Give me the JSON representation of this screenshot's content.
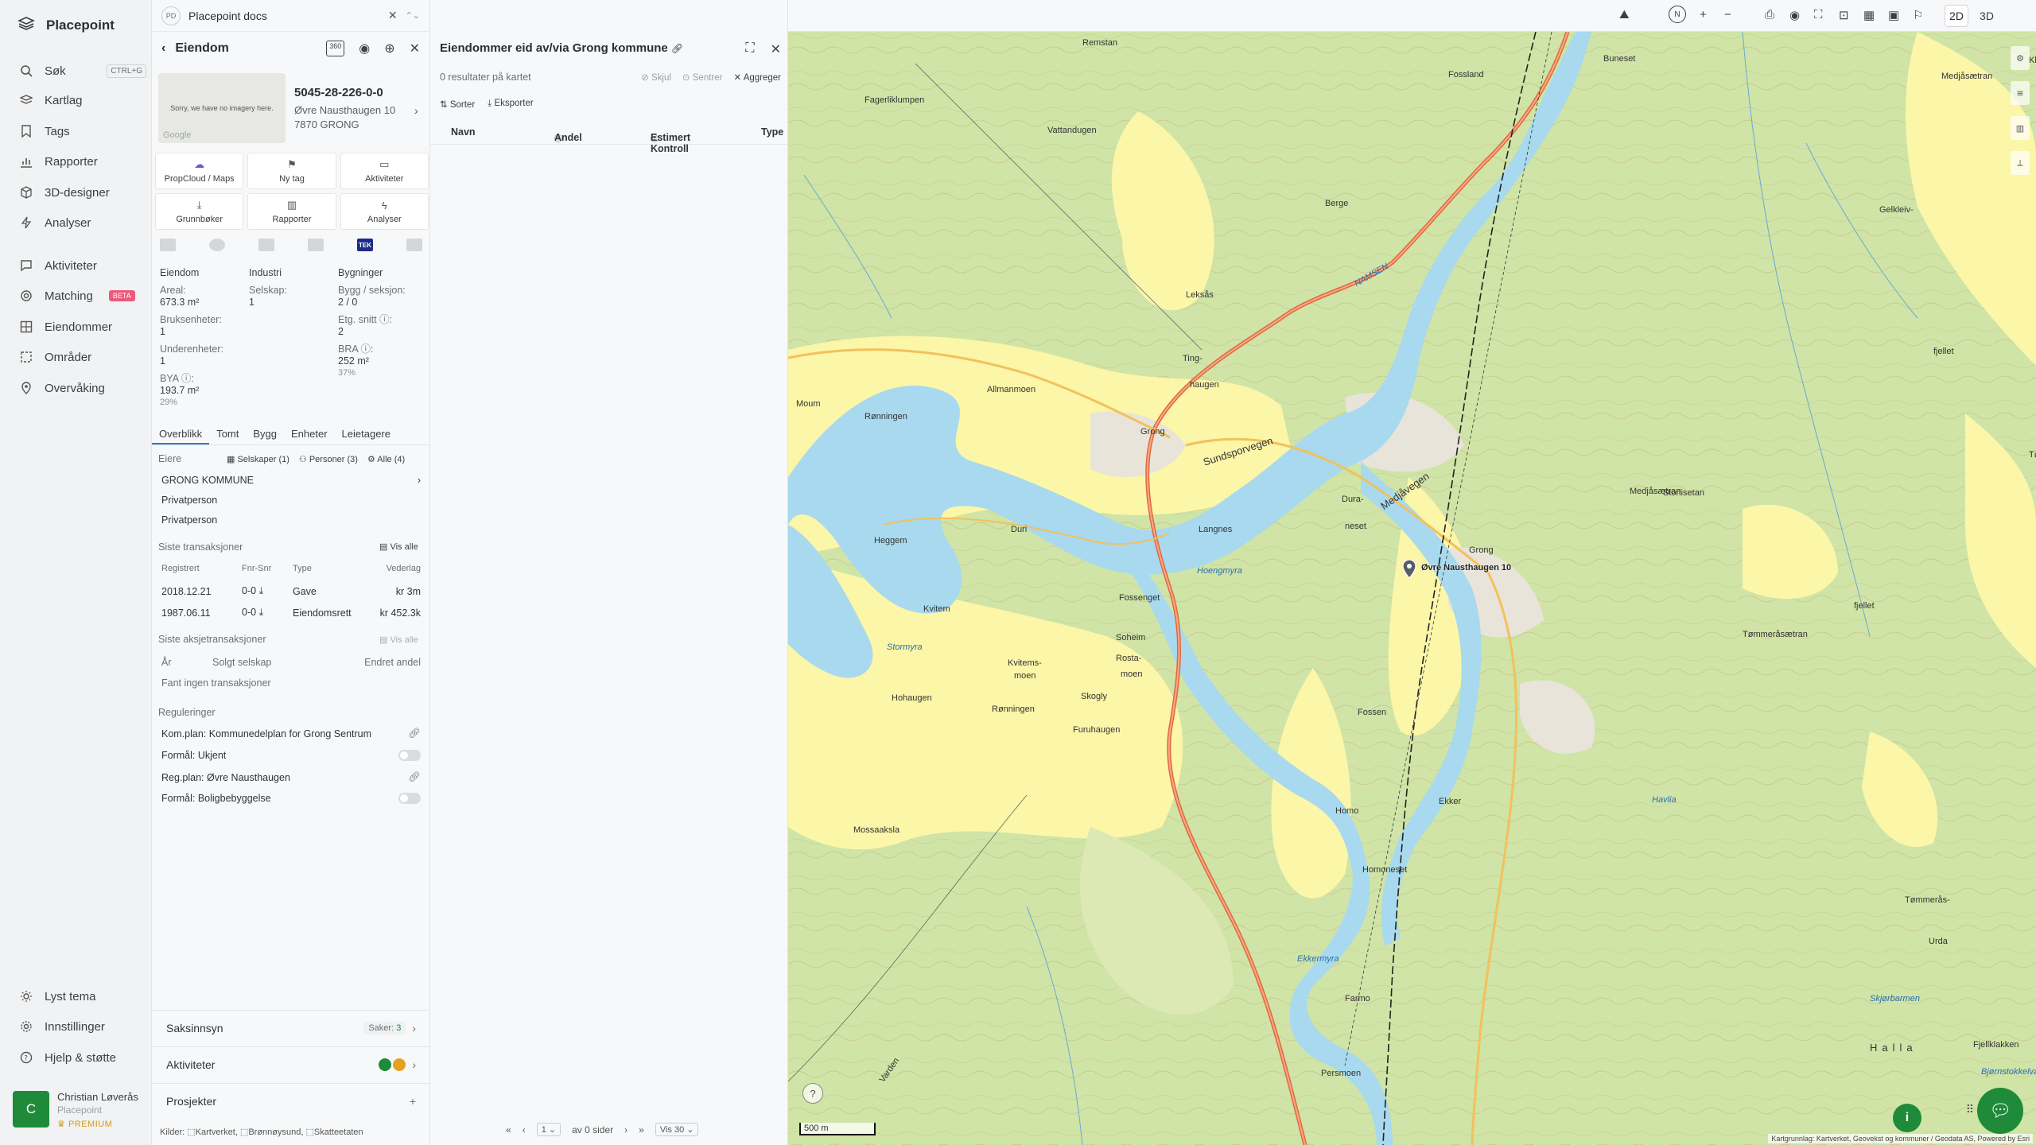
{
  "nav": {
    "brand": "Placepoint",
    "items": [
      {
        "label": "Søk",
        "icon": "search-icon",
        "shortcut": "CTRL+G"
      },
      {
        "label": "Kartlag",
        "icon": "layers-icon"
      },
      {
        "label": "Tags",
        "icon": "bookmark-icon"
      },
      {
        "label": "Rapporter",
        "icon": "chart-icon"
      },
      {
        "label": "3D-designer",
        "icon": "cube-icon"
      },
      {
        "label": "Analyser",
        "icon": "bolt-icon"
      },
      {
        "label": "Aktiviteter",
        "icon": "chat-icon"
      },
      {
        "label": "Matching",
        "icon": "target-icon",
        "badge": "BETA"
      },
      {
        "label": "Eiendommer",
        "icon": "grid-icon"
      },
      {
        "label": "Områder",
        "icon": "area-icon"
      },
      {
        "label": "Overvåking",
        "icon": "pin-icon"
      }
    ],
    "bottom": [
      {
        "label": "Lyst tema",
        "icon": "sun-icon"
      },
      {
        "label": "Innstillinger",
        "icon": "gear-icon"
      },
      {
        "label": "Hjelp & støtte",
        "icon": "help-icon"
      }
    ],
    "user": {
      "initial": "C",
      "name": "Christian Løverås",
      "org": "Placepoint",
      "plan": "PREMIUM"
    }
  },
  "property": {
    "doc_badge": "PD",
    "doc_title": "Placepoint docs",
    "header": "Eiendom",
    "thumb_text": "Sorry, we have no imagery here.",
    "thumb_google": "Google",
    "id": "5045-28-226-0-0",
    "address1": "Øvre Nausthaugen 10",
    "address2": "7870 GRONG",
    "tiles": [
      {
        "label": "PropCloud / Maps",
        "icon": "cloud-icon"
      },
      {
        "label": "Ny tag",
        "icon": "bookmark-icon"
      },
      {
        "label": "Aktiviteter",
        "icon": "chat-icon"
      },
      {
        "label": "Grunnbøker",
        "icon": "download-icon"
      },
      {
        "label": "Rapporter",
        "icon": "chart-icon"
      },
      {
        "label": "Analyser",
        "icon": "bolt-icon"
      }
    ],
    "src_tek": "TEK",
    "stats": {
      "c1_head": "Eiendom",
      "areal_label": "Areal:",
      "areal": "673.3 m²",
      "bruks_label": "Bruksenheter:",
      "bruks": "1",
      "under_label": "Underenheter:",
      "under": "1",
      "bya_label": "BYA ⓘ:",
      "bya": "193.7 m²",
      "bya_pct": "29%",
      "c2_head": "Industri",
      "selskap_label": "Selskap:",
      "selskap": "1",
      "c3_head": "Bygninger",
      "bygg_label": "Bygg / seksjon:",
      "bygg": "2 / 0",
      "etg_label": "Etg. snitt ⓘ:",
      "etg": "2",
      "bra_label": "BRA ⓘ:",
      "bra": "252 m²",
      "bra_pct": "37%"
    },
    "tabs": [
      "Overblikk",
      "Tomt",
      "Bygg",
      "Enheter",
      "Leietagere"
    ],
    "owners_label": "Eiere",
    "owners_filters": [
      "Selskaper (1)",
      "Personer (3)",
      "Alle (4)"
    ],
    "owners": [
      "GRONG KOMMUNE",
      "Privatperson",
      "Privatperson"
    ],
    "tx_label": "Siste transaksjoner",
    "tx_all": "Vis alle",
    "tx_cols": [
      "Registrert",
      "Fnr-Snr",
      "Type",
      "Vederlag"
    ],
    "tx_rows": [
      {
        "date": "2018.12.21",
        "fnr": "0-0",
        "type": "Gave",
        "amount": "kr 3m"
      },
      {
        "date": "1987.06.11",
        "fnr": "0-0",
        "type": "Eiendomsrett",
        "amount": "kr 452.3k"
      }
    ],
    "share_label": "Siste aksjetransaksjoner",
    "share_all": "Vis alle",
    "share_cols": [
      "År",
      "Solgt selskap",
      "Endret andel"
    ],
    "share_empty": "Fant ingen transaksjoner",
    "reg_label": "Reguleringer",
    "reg": [
      {
        "text": "Kom.plan: Kommunedelplan for Grong Sentrum",
        "ctl": "link"
      },
      {
        "text": "Formål: Ukjent",
        "ctl": "toggle"
      },
      {
        "text": "Reg.plan: Øvre Nausthaugen",
        "ctl": "link"
      },
      {
        "text": "Formål: Boligbebyggelse",
        "ctl": "toggle"
      }
    ],
    "saksinnsyn": "Saksinnsyn",
    "saker_label": "Saker:",
    "saker": "3",
    "aktiviteter": "Aktiviteter",
    "prosjekter": "Prosjekter",
    "kilder": "Kilder:",
    "kilder_list": [
      "Kartverket,",
      "Brønnøysund,",
      "Skatteetaten"
    ]
  },
  "list": {
    "title": "Eiendommer eid av/via Grong kommune",
    "results": "0 resultater på kartet",
    "actions": [
      "Skjul",
      "Sentrer",
      "Aggreger"
    ],
    "sort": "Sorter",
    "export": "Eksporter",
    "columns": [
      "Navn",
      "Andel",
      "Estimert Kontroll",
      "Type"
    ],
    "page_value": "1",
    "page_text": "av 0 sider",
    "per_page": "Vis 30"
  },
  "map": {
    "mode_2d": "2D",
    "mode_3d": "3D",
    "scale": "500 m",
    "attribution": "Kartgrunnlag: Kartverket, Geovekst og kommuner / Geodata AS, Powered by Esri",
    "pin_label": "Øvre Nausthaugen 10",
    "labels": [
      "Remstan",
      "Fossland",
      "Buneset",
      "Klumpen",
      "Medjåsætran",
      "Fagerliklumpen",
      "Vattandugen",
      "Berge",
      "Gelkleiv-",
      "Leksås",
      "Ting-",
      "haugen",
      "NAMSEN",
      "Allmanmoen",
      "Grong",
      "Sundsporvegen",
      "Medjåvegen",
      "Dura-",
      "neset",
      "Langnes",
      "Moum",
      "Rønningen",
      "Heggem",
      "Duri",
      "Fossenget",
      "Grong",
      "Medjåsætran",
      "Storlisetan",
      "Tømmeråsætran",
      "Tømmerås-",
      "fjellet",
      "fjellet",
      "Kvitem",
      "Soheim",
      "Rosta-",
      "moen",
      "Kvitems-",
      "moen",
      "Hohaugen",
      "Rønningen",
      "Skogly",
      "Furuhaugen",
      "Mossaaksla",
      "Fossen",
      "Ekker",
      "Homo",
      "Homoneset",
      "Hoengmyra",
      "Stormyra",
      "Tømmerås-",
      "Urda",
      "Halla",
      "Farmo",
      "Persmoen",
      "Bjørnstokkelva",
      "Fjellklakken",
      "Skjørbarmen",
      "Ekkermyra",
      "Varden",
      "Havlia"
    ]
  }
}
